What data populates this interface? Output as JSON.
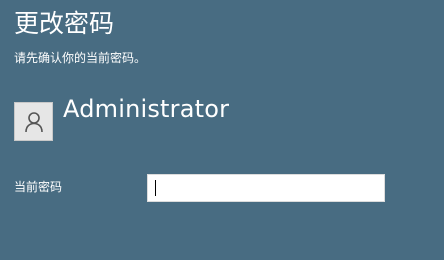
{
  "page": {
    "title": "更改密码",
    "subtitle": "请先确认你的当前密码。"
  },
  "account": {
    "username": "Administrator",
    "avatar_icon": "user-icon"
  },
  "form": {
    "current_password_label": "当前密码",
    "current_password_value": "",
    "current_password_placeholder": ""
  },
  "colors": {
    "background": "#486c82",
    "text": "#ffffff",
    "input_background": "#ffffff"
  }
}
